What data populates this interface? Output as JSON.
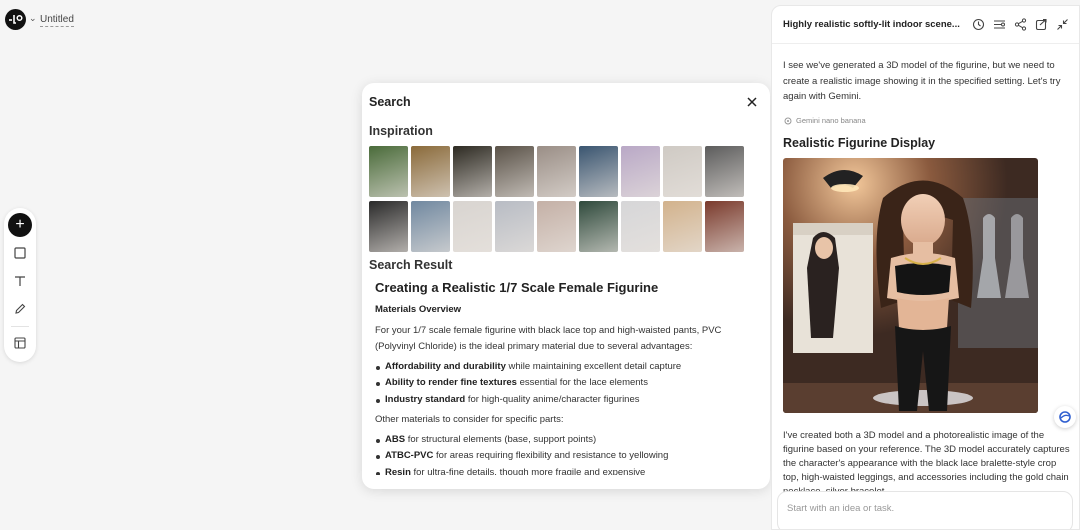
{
  "document": {
    "title": "Untitled"
  },
  "toolbar": {
    "add_label": "+",
    "tools": [
      "add",
      "rectangle",
      "text",
      "pencil",
      "layout"
    ]
  },
  "search_modal": {
    "title": "Search",
    "inspiration_title": "Inspiration",
    "thumbnail_colors": [
      "#4a6b3a",
      "#8a6a3a",
      "#2d2a22",
      "#5a5248",
      "#9a8e86",
      "#3a5570",
      "#b9a8c6",
      "#cfcac4",
      "#5c5c5c",
      "#2a2a2a",
      "#7088a0",
      "#d8d4d0",
      "#b8bcc4",
      "#c4b0a6",
      "#2f4a3c",
      "#d6d6d8",
      "#d2b28c",
      "#7a3a2c"
    ],
    "result_title": "Search Result",
    "article": {
      "heading": "Creating a Realistic 1/7 Scale Female Figurine",
      "subheading": "Materials Overview",
      "intro": "For your 1/7 scale female figurine with black lace top and high-waisted pants, PVC (Polyvinyl Chloride) is the ideal primary material due to several advantages:",
      "advantages": [
        {
          "bold": "Affordability and durability",
          "text": " while maintaining excellent detail capture"
        },
        {
          "bold": "Ability to render fine textures",
          "text": " essential for the lace elements"
        },
        {
          "bold": "Industry standard",
          "text": " for high-quality anime/character figurines"
        }
      ],
      "other_intro": "Other materials to consider for specific parts:",
      "other_materials": [
        {
          "bold": "ABS",
          "text": " for structural elements (base, support points)"
        },
        {
          "bold": "ATBC-PVC",
          "text": " for areas requiring flexibility and resistance to yellowing"
        },
        {
          "bold": "Resin",
          "text": " for ultra-fine details, though more fragile and expensive"
        }
      ]
    }
  },
  "chat": {
    "title": "Highly realistic softly-lit indoor scene...",
    "message": "I see we've generated a 3D model of the figurine, but we need to create a realistic image showing it in the specified setting. Let's try again with Gemini.",
    "model_tag": "Gemini nano banana",
    "result_heading": "Realistic Figurine Display",
    "reply": "I've created both a 3D model and a photorealistic image of the figurine based on your reference. The 3D model accurately captures the character's appearance with the black lace bralette-style crop top, high-waisted leggings, and accessories including the gold chain necklace, silver bracelet",
    "input_placeholder": "Start with an idea or task.",
    "header_icons": [
      "history-icon",
      "settings-sliders-icon",
      "share-icon",
      "open-external-icon",
      "collapse-icon"
    ]
  },
  "colors": {
    "accent": "#2f5fd0",
    "text": "#222222",
    "muted": "#999999"
  }
}
